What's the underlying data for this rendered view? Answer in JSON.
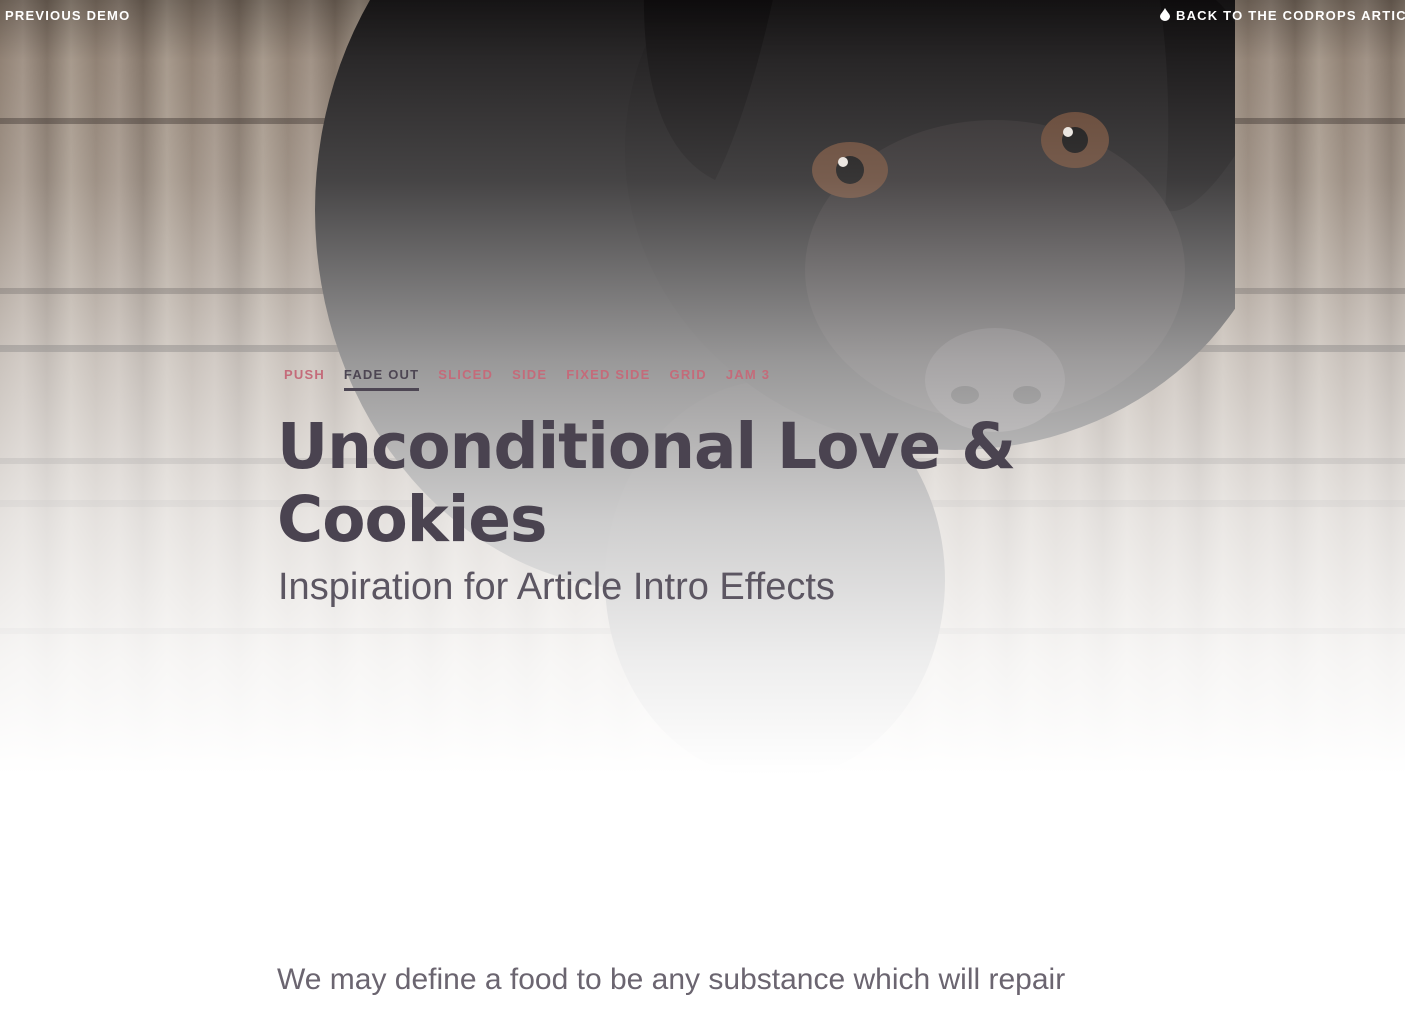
{
  "top_bar": {
    "previous_demo": "PREVIOUS DEMO",
    "back_to_article": "BACK TO THE CODROPS ARTICL"
  },
  "demo_nav": {
    "items": [
      {
        "label": "PUSH",
        "current": false
      },
      {
        "label": "FADE OUT",
        "current": true
      },
      {
        "label": "SLICED",
        "current": false
      },
      {
        "label": "SIDE",
        "current": false
      },
      {
        "label": "FIXED SIDE",
        "current": false
      },
      {
        "label": "GRID",
        "current": false
      },
      {
        "label": "JAM 3",
        "current": false
      }
    ]
  },
  "header": {
    "title": "Unconditional Love & Cookies",
    "subtitle": "Inspiration for Article Intro Effects"
  },
  "content": {
    "first_line": "We may define a food to be any substance which will repair"
  },
  "colors": {
    "nav_link": "#c46b7a",
    "nav_current": "#4d4653",
    "title": "#4a4350",
    "text": "#6b6570"
  },
  "icons": {
    "back_link_icon": "drop-icon"
  }
}
